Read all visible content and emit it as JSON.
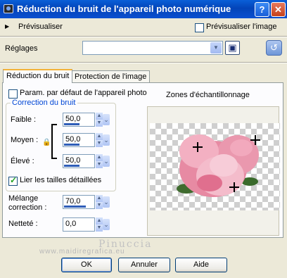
{
  "window": {
    "title": "Réduction du bruit de l'appareil photo numérique",
    "help_glyph": "?",
    "close_glyph": "✕"
  },
  "preview": {
    "toggle_glyph": "▶",
    "label": "Prévisualiser",
    "preview_image_label": "Prévisualiser l'image",
    "preview_image_checked": false
  },
  "presets": {
    "label": "Réglages",
    "value": "",
    "arrow_glyph": "▼",
    "save_glyph": "💾",
    "reset_glyph": "⟲"
  },
  "tabs": [
    {
      "label": "Réduction du bruit",
      "active": true
    },
    {
      "label": "Protection de l'image",
      "active": false
    }
  ],
  "defaults": {
    "label": "Param. par défaut de l'appareil photo",
    "checked": false
  },
  "correction": {
    "title": "Correction du bruit",
    "faible": {
      "label": "Faible :",
      "value": "50,0",
      "fill": 0.5
    },
    "moyen": {
      "label": "Moyen :",
      "value": "50,0",
      "fill": 0.5
    },
    "eleve": {
      "label": "Élevé :",
      "value": "50,0",
      "fill": 0.5
    },
    "lock_glyph": "🔒"
  },
  "link": {
    "label": "Lier les tailles détaillées",
    "checked": true
  },
  "melange": {
    "label_line1": "Mélange",
    "label_line2": "correction :",
    "value": "70,0",
    "fill": 0.7
  },
  "nettete": {
    "label": "Netteté :",
    "value": "0,0",
    "fill": 0.0
  },
  "zones": {
    "title": "Zones d'échantillonnage"
  },
  "watermark": {
    "name": "Pinuccia",
    "site": "www.maidiregrafica.eu"
  },
  "buttons": {
    "ok": "OK",
    "cancel": "Annuler",
    "help": "Aide"
  },
  "spin": {
    "up": "▲",
    "down": "▼",
    "chevron": "❯"
  }
}
